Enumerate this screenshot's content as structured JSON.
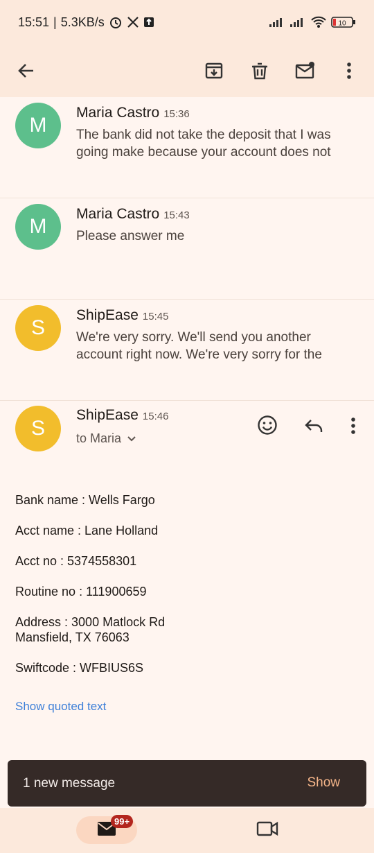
{
  "status": {
    "time": "15:51",
    "speed": "5.3KB/s",
    "battery": "10"
  },
  "colors": {
    "header_bg": "#fce9dc",
    "avatar_m": "#5dbf8c",
    "avatar_s": "#f2bd2c",
    "link": "#3d7fd8",
    "snackbar_bg": "#352a27",
    "snackbar_action": "#f6b68a",
    "badge": "#b3261e"
  },
  "toolbar": {
    "icons": [
      "back-arrow-icon",
      "archive-icon",
      "delete-icon",
      "mark-unread-icon",
      "more-icon"
    ]
  },
  "messages": [
    {
      "initial": "M",
      "sender": "Maria Castro",
      "time": "15:36",
      "snippet": "The bank did not take the deposit that I was going make because your account does not"
    },
    {
      "initial": "M",
      "sender": "Maria Castro",
      "time": "15:43",
      "snippet": "Please answer me"
    },
    {
      "initial": "S",
      "sender": "ShipEase",
      "time": "15:45",
      "snippet": "We're very sorry. We'll send you another account right now. We're very sorry for the"
    }
  ],
  "open_message": {
    "initial": "S",
    "sender": "ShipEase",
    "time": "15:46",
    "recipient": "to Maria",
    "body": [
      "Bank name : Wells Fargo",
      "Acct name : Lane Holland",
      "Acct no : 5374558301",
      "Routine no : 111900659",
      "Address : 3000 Matlock Rd\nMansfield, TX 76063",
      "Swiftcode : WFBIUS6S"
    ],
    "quoted_link": "Show quoted text"
  },
  "snackbar": {
    "text": "1 new message",
    "action": "Show"
  },
  "bottom_nav": {
    "mail_badge": "99+"
  }
}
